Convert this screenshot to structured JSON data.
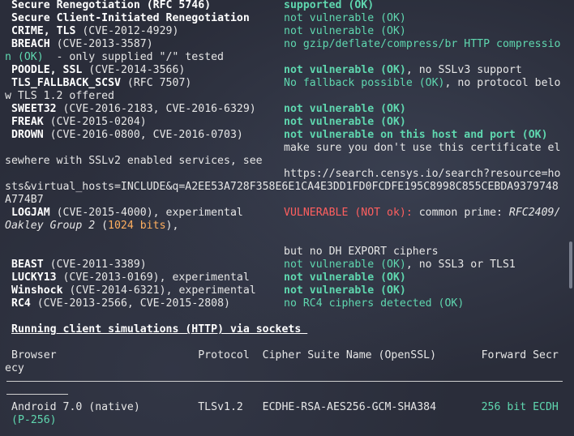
{
  "lines": [
    {
      "l": [
        [
          "Secure Renegotiation (RFC 5746)",
          "b"
        ]
      ],
      "r": [
        [
          "supported (OK)",
          "gb"
        ]
      ]
    },
    {
      "l": [
        [
          "Secure Client-Initiated Renegotiation",
          "b"
        ]
      ],
      "r": [
        [
          "not vulnerable (OK)",
          "g"
        ]
      ]
    },
    {
      "l": [
        [
          "CRIME, TLS",
          "b"
        ],
        [
          " (CVE-2012-4929)",
          ""
        ]
      ],
      "r": [
        [
          "not vulnerable (OK)",
          "g"
        ]
      ]
    },
    {
      "l": [
        [
          "BREACH",
          "b"
        ],
        [
          " (CVE-2013-3587)",
          ""
        ]
      ],
      "r": [
        [
          "no gzip/deflate/compress/br HTTP compressio",
          "g"
        ]
      ]
    },
    {
      "l": [
        [
          "n (OK)",
          "g"
        ],
        [
          "  - only supplied \"/\" tested",
          ""
        ]
      ]
    },
    {
      "l": [
        [
          "POODLE, SSL",
          "b"
        ],
        [
          " (CVE-2014-3566)",
          ""
        ]
      ],
      "r": [
        [
          "not vulnerable (OK)",
          "gb"
        ],
        [
          ", no SSLv3 support",
          ""
        ]
      ]
    },
    {
      "l": [
        [
          "TLS_FALLBACK_SCSV",
          "b"
        ],
        [
          " (RFC 7507)",
          ""
        ]
      ],
      "r": [
        [
          "No fallback possible (OK)",
          "g"
        ],
        [
          ", no protocol belo",
          ""
        ]
      ]
    },
    {
      "l": [
        [
          "w TLS 1.2 offered",
          ""
        ]
      ]
    },
    {
      "l": [
        [
          "SWEET32",
          "b"
        ],
        [
          " (CVE-2016-2183, CVE-2016-6329)",
          ""
        ]
      ],
      "r": [
        [
          "not vulnerable (OK)",
          "gb"
        ]
      ]
    },
    {
      "l": [
        [
          "FREAK",
          "b"
        ],
        [
          " (CVE-2015-0204)",
          ""
        ]
      ],
      "r": [
        [
          "not vulnerable (OK)",
          "gb"
        ]
      ]
    },
    {
      "l": [
        [
          "DROWN",
          "b"
        ],
        [
          " (CVE-2016-0800, CVE-2016-0703)",
          ""
        ]
      ],
      "r": [
        [
          "not vulnerable on this host and port (OK)",
          "gb"
        ]
      ]
    },
    {
      "r": [
        [
          "make sure you don't use this certificate el",
          ""
        ]
      ]
    },
    {
      "l": [
        [
          "sewhere with SSLv2 enabled services, see",
          ""
        ]
      ]
    },
    {
      "r": [
        [
          "https://search.censys.io/search?resource=ho",
          ""
        ]
      ]
    },
    {
      "l": [
        [
          "sts&virtual_hosts=INCLUDE&q=A2EE53A728F358E6E1CA4E3DD1FD0FCDFE195C8998C855CEBDA9379748",
          ""
        ]
      ]
    },
    {
      "l": [
        [
          "A774B7",
          ""
        ]
      ]
    },
    {
      "l": [
        [
          "LOGJAM",
          "b"
        ],
        [
          " (CVE-2015-4000), experimental",
          ""
        ]
      ],
      "r": [
        [
          "VULNERABLE (NOT ok):",
          "r"
        ],
        [
          " common prime: ",
          ""
        ],
        [
          "RFC2409/",
          "i"
        ]
      ]
    },
    {
      "l": [
        [
          "Oakley Group 2",
          "i"
        ],
        [
          " (",
          ""
        ],
        [
          "1024 bits",
          "o"
        ],
        [
          "),",
          ""
        ]
      ]
    },
    {},
    {
      "r": [
        [
          "but no DH EXPORT ciphers",
          ""
        ]
      ]
    },
    {
      "l": [
        [
          "BEAST",
          "b"
        ],
        [
          " (CVE-2011-3389)",
          ""
        ]
      ],
      "r": [
        [
          "not vulnerable (OK)",
          "g"
        ],
        [
          ", no SSL3 or TLS1",
          ""
        ]
      ]
    },
    {
      "l": [
        [
          "LUCKY13",
          "b"
        ],
        [
          " (CVE-2013-0169), experimental",
          ""
        ]
      ],
      "r": [
        [
          "not vulnerable (OK)",
          "gb"
        ]
      ]
    },
    {
      "l": [
        [
          "Winshock",
          "b"
        ],
        [
          " (CVE-2014-6321), experimental",
          ""
        ]
      ],
      "r": [
        [
          "not vulnerable (OK)",
          "gb"
        ]
      ]
    },
    {
      "l": [
        [
          "RC4",
          "b"
        ],
        [
          " (CVE-2013-2566, CVE-2015-2808)",
          ""
        ]
      ],
      "r": [
        [
          "no RC4 ciphers detected (OK)",
          "g"
        ]
      ]
    },
    {},
    {
      "l": [
        [
          "Running client simulations (HTTP) via sockets ",
          "u"
        ]
      ]
    },
    {},
    {
      "l": [
        [
          "Browser                      Protocol  Cipher Suite Name (OpenSSL)       Forward Secr",
          ""
        ]
      ]
    },
    {
      "l": [
        [
          "ecy",
          ""
        ]
      ]
    },
    {},
    {},
    {
      "l": [
        [
          "Android 7.0 (native)         TLSv1.2   ECDHE-RSA-AES256-GCM-SHA384       ",
          ""
        ],
        [
          "256 bit ECDH",
          "g"
        ]
      ]
    },
    {
      "l": [
        [
          "(P-256)",
          "g"
        ]
      ]
    }
  ]
}
